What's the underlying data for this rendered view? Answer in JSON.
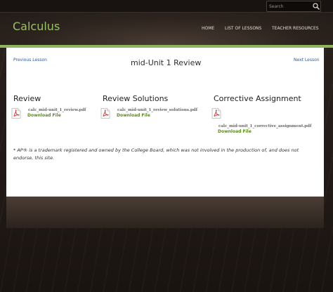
{
  "search": {
    "placeholder": "Search"
  },
  "site": {
    "title": "Calculus"
  },
  "nav": [
    "HOME",
    "LIST OF LESSONS",
    "TEACHER RESOURCES"
  ],
  "page": {
    "previous_label": "Previous Lesson",
    "next_label": "Next Lesson",
    "title": "mid-Unit 1 Review"
  },
  "sections": [
    {
      "heading": "Review",
      "filename": "calc_mid-unit_1_review.pdf",
      "download": "Download File"
    },
    {
      "heading": "Review Solutions",
      "filename": "calc_mid-unit_1_review_solutions.pdf",
      "download": "Download File"
    },
    {
      "heading": "Corrective Assignment",
      "filename": "calc_mid-unit_1_corrective_assignment.pdf",
      "download": "Download File"
    }
  ],
  "note": "* AP® is a trademark registered and owned by the College Board, which was not involved in the production of, and does not endorse, this site.",
  "colors": {
    "accent_green": "#8fb45c",
    "title_green": "#9cc06a",
    "link_blue": "#305a9e",
    "download_green": "#5b8a21"
  },
  "icons": {
    "search": "magnifier-icon",
    "file": "pdf-file-icon"
  }
}
